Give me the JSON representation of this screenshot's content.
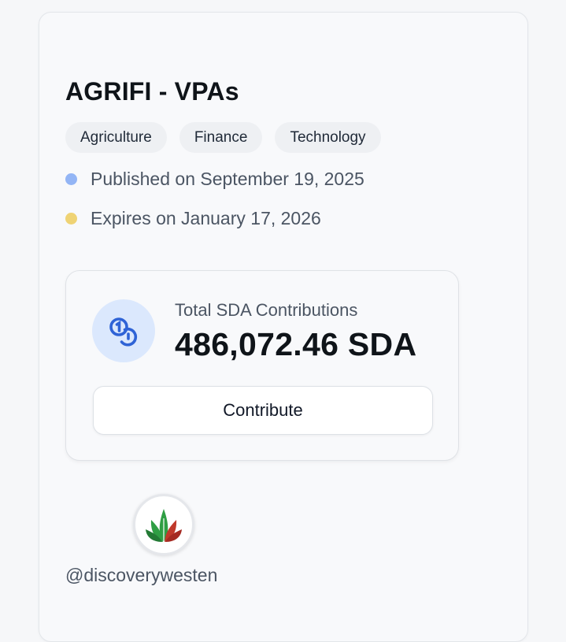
{
  "project": {
    "title": "AGRIFI - VPAs",
    "tags": [
      "Agriculture",
      "Finance",
      "Technology"
    ],
    "published": "Published on September 19, 2025",
    "expires": "Expires on January 17, 2026"
  },
  "contributions": {
    "label": "Total SDA Contributions",
    "amount": "486,072.46 SDA",
    "button_label": "Contribute",
    "icon": "coins-icon"
  },
  "author": {
    "handle": "@discoverywesten",
    "avatar_icon": "leaf-logo"
  },
  "colors": {
    "published_dot": "#93b5f5",
    "expires_dot": "#efd374",
    "coin_bg": "#dbe8fd",
    "coin_stroke": "#2f63d6"
  }
}
